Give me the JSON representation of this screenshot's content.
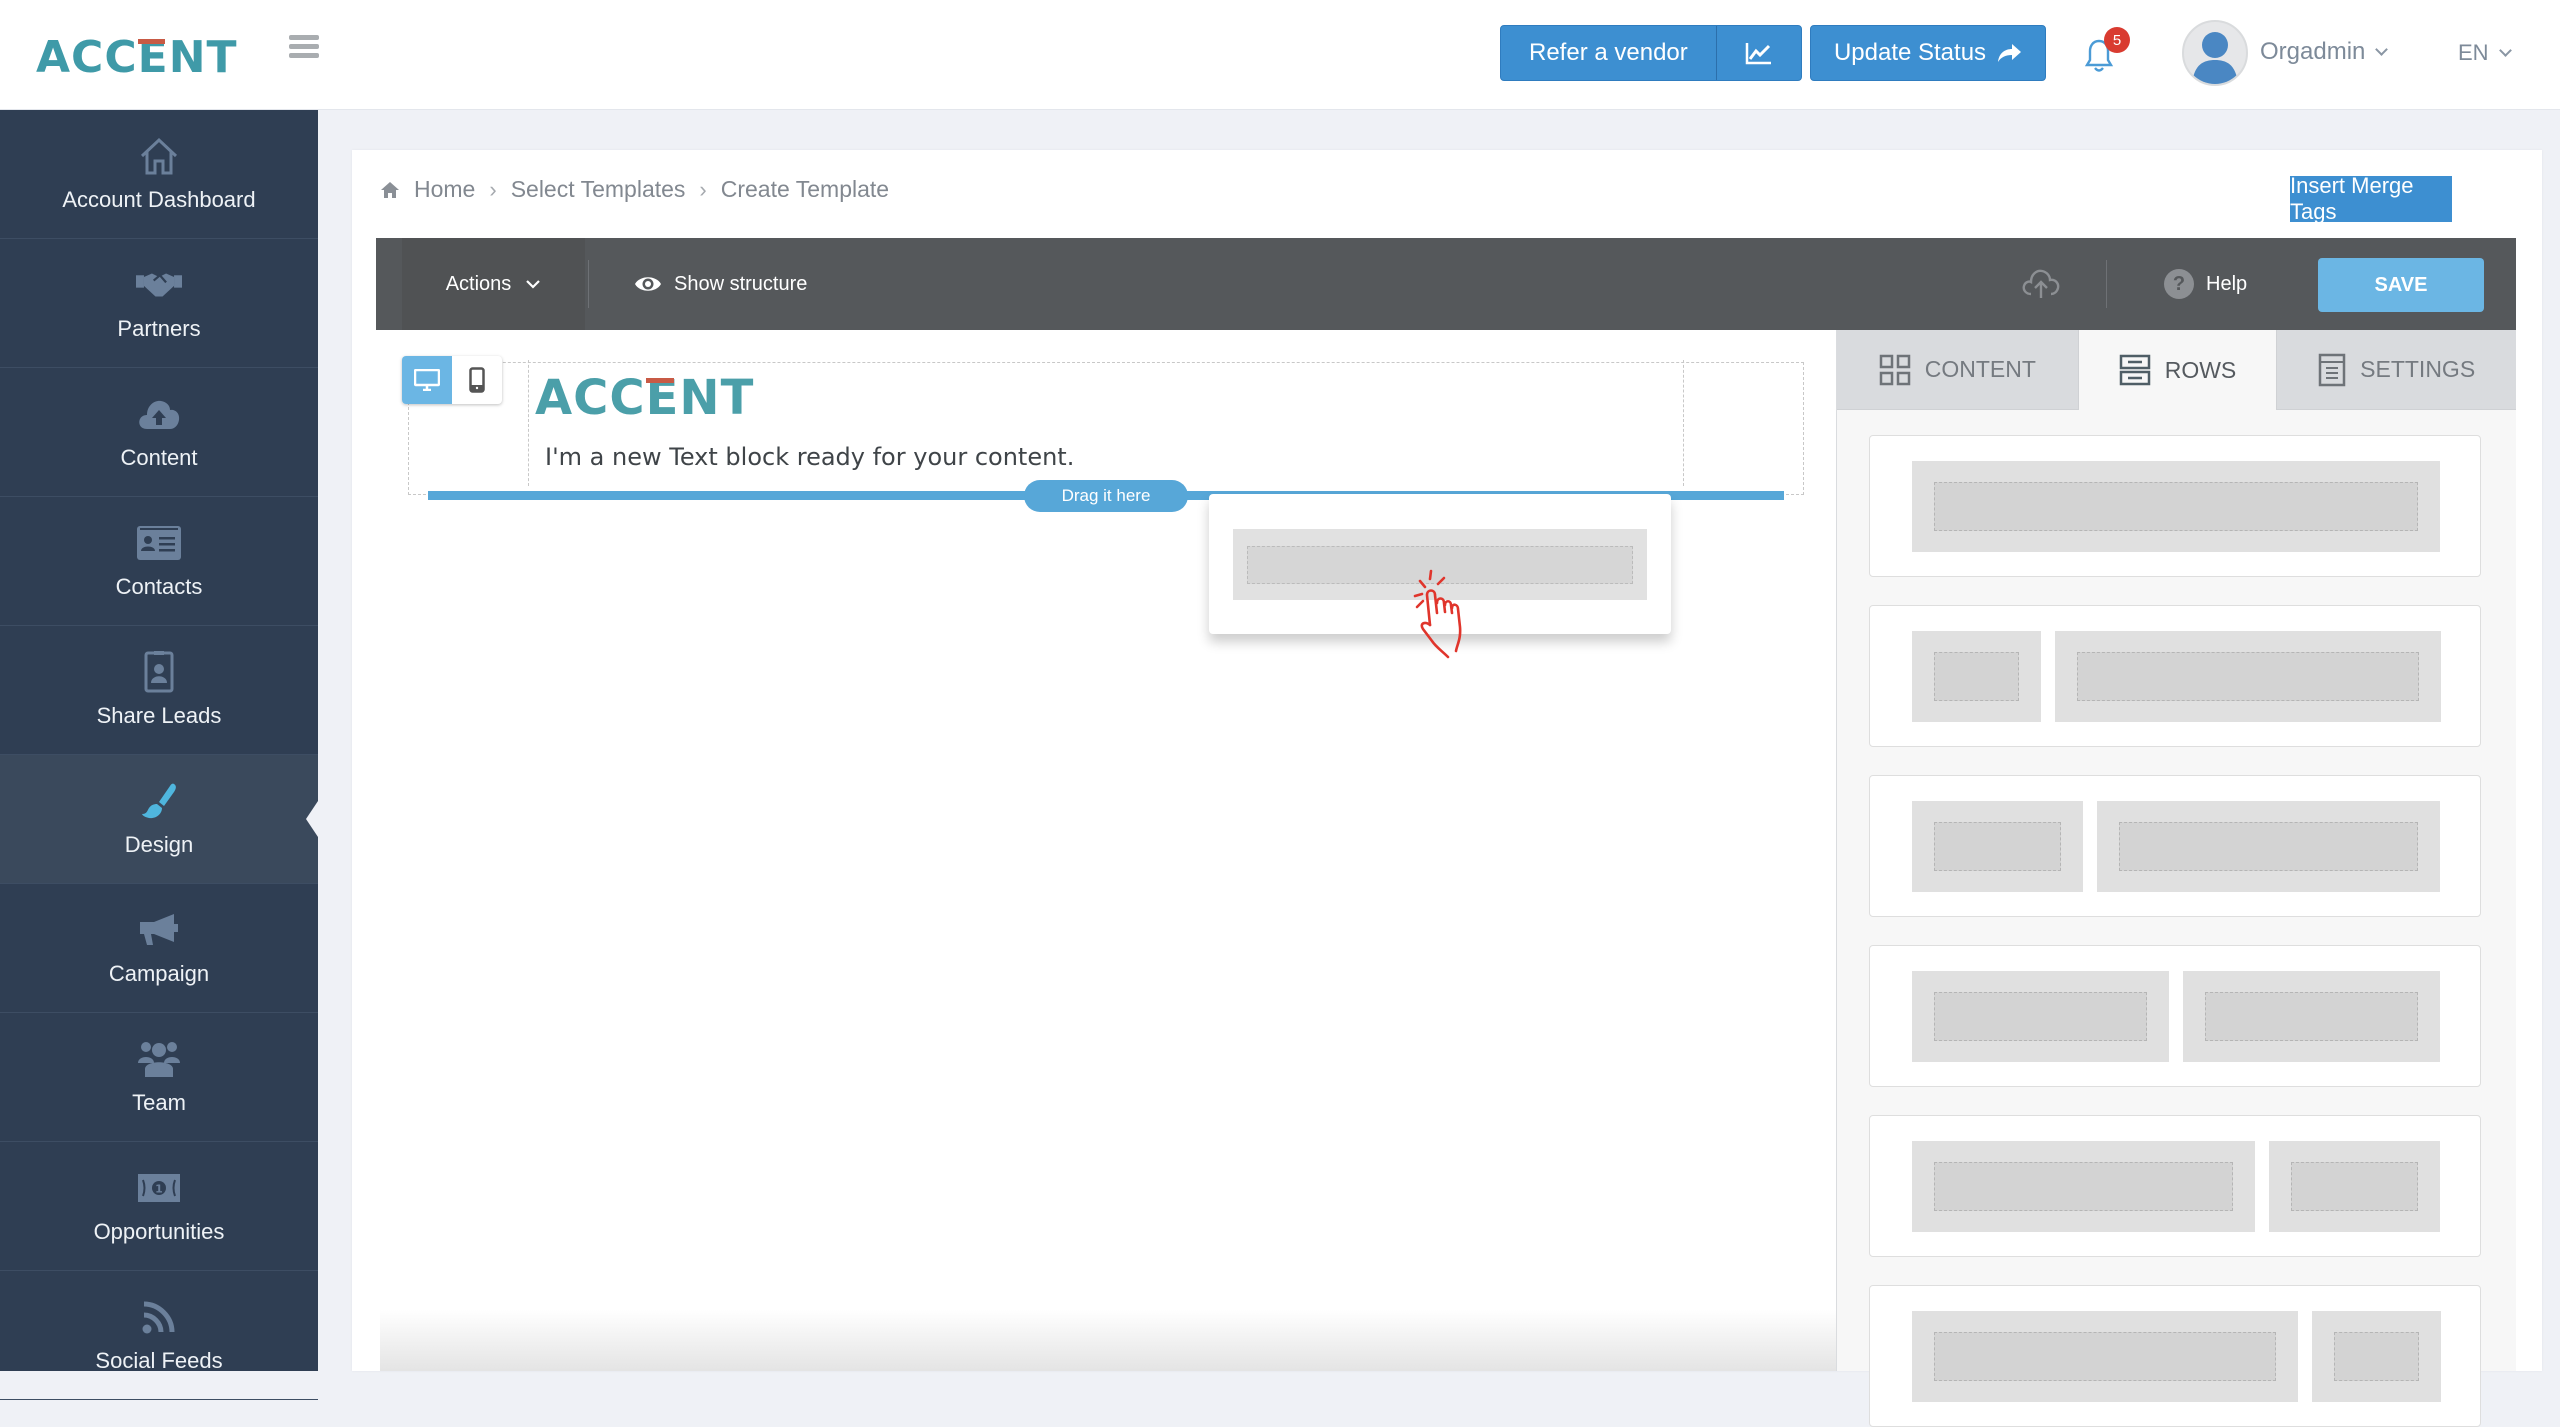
{
  "header": {
    "logo": {
      "pre": "ACC",
      "e": "E",
      "post": "NT"
    },
    "refer_vendor_label": "Refer a vendor",
    "update_status_label": "Update Status",
    "notification_count": "5",
    "user_name": "Orgadmin",
    "language": "EN"
  },
  "sidebar": {
    "active": "Design",
    "items": [
      {
        "label": "Account Dashboard",
        "icon": "home-icon"
      },
      {
        "label": "Partners",
        "icon": "handshake-icon"
      },
      {
        "label": "Content",
        "icon": "cloud-upload-icon"
      },
      {
        "label": "Contacts",
        "icon": "id-card-icon"
      },
      {
        "label": "Share Leads",
        "icon": "badge-icon"
      },
      {
        "label": "Design",
        "icon": "paintbrush-icon"
      },
      {
        "label": "Campaign",
        "icon": "megaphone-icon"
      },
      {
        "label": "Team",
        "icon": "users-icon"
      },
      {
        "label": "Opportunities",
        "icon": "money-icon"
      },
      {
        "label": "Social Feeds",
        "icon": "rss-icon"
      }
    ]
  },
  "breadcrumb": [
    "Home",
    "Select Templates",
    "Create Template"
  ],
  "insert_merge_tags_label": "Insert Merge Tags",
  "editor": {
    "actions_label": "Actions",
    "show_structure_label": "Show structure",
    "help_label": "Help",
    "save_label": "SAVE",
    "help_glyph": "?"
  },
  "canvas": {
    "logo": {
      "pre": "ACC",
      "e": "E",
      "post": "NT"
    },
    "text_block": "I'm a new Text block ready for your content.",
    "drop_hint": "Drag it here"
  },
  "panel": {
    "tabs": [
      {
        "label": "CONTENT",
        "active": false
      },
      {
        "label": "ROWS",
        "active": true
      },
      {
        "label": "SETTINGS",
        "active": false
      }
    ],
    "row_layouts": [
      {
        "columns": [
          12
        ]
      },
      {
        "columns": [
          3,
          9
        ]
      },
      {
        "columns": [
          4,
          8
        ]
      },
      {
        "columns": [
          6,
          6
        ]
      },
      {
        "columns": [
          8,
          4
        ]
      },
      {
        "columns": [
          9,
          3
        ]
      }
    ]
  },
  "colors": {
    "brand_teal": "#3f9aa8",
    "brand_red": "#c85a45",
    "primary_blue": "#3d8fd1",
    "save_blue": "#6bb6e4",
    "sidebar_bg": "#2f3e53",
    "active_icon": "#4fb6de",
    "badge_red": "#d93b30"
  }
}
